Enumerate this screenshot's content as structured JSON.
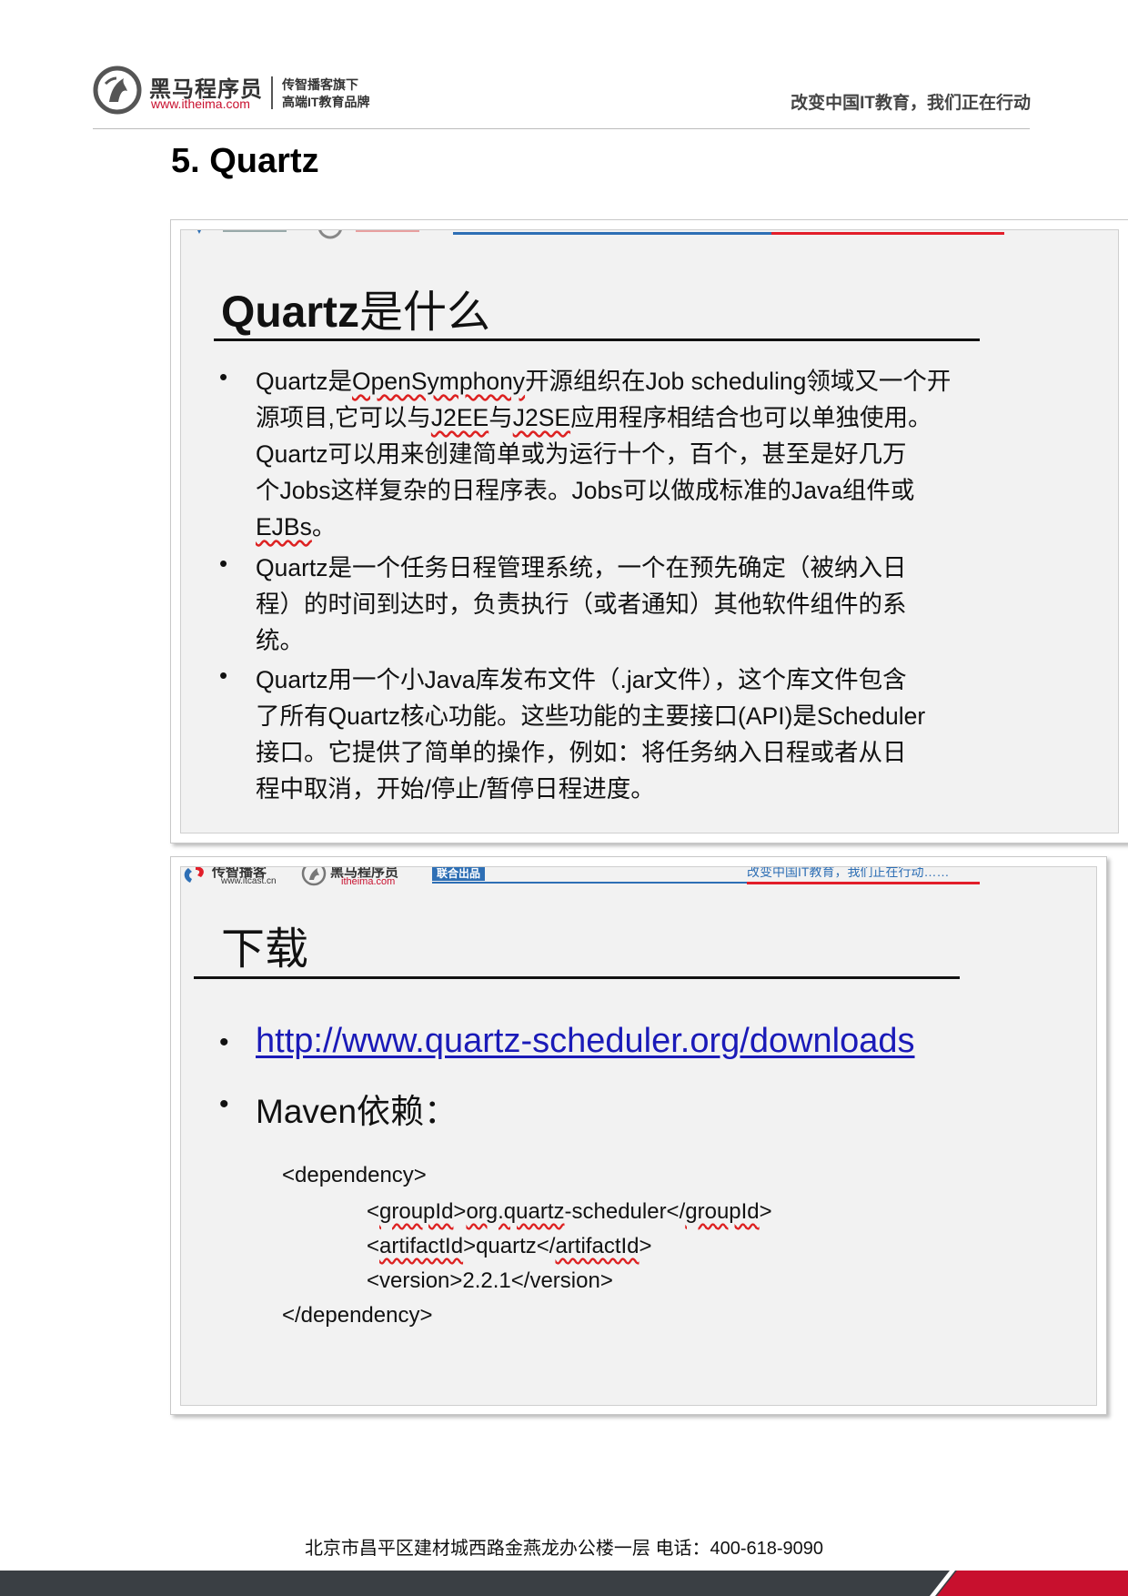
{
  "header": {
    "logo_name": "黑马程序员",
    "logo_url": "www.itheima.com",
    "logo_sub1": "传智播客旗下",
    "logo_sub2": "高端IT教育品牌",
    "slogan": "改变中国IT教育，我们正在行动"
  },
  "section_title": "5. Quartz",
  "slide1": {
    "title_lat": "Quartz",
    "title_cjk": "是什么",
    "bullets": [
      [
        [
          "Quartz是",
          "OpenSymphony",
          "开源组织在Job scheduling领域又一个开"
        ],
        [
          "源项目,它可以与",
          "J2EE",
          "与",
          "J2SE",
          "应用程序相结合也可以单独使用。"
        ],
        [
          "Quartz可以用来创建简单或为运行十个，百个，甚至是好几万"
        ],
        [
          "个Jobs这样复杂的日程序表。Jobs可以做成标准的Java组件或"
        ],
        [
          "EJBs",
          "。"
        ]
      ],
      [
        [
          "Quartz是一个任务日程管理系统，一个在预先确定（被纳入日"
        ],
        [
          "程）的时间到达时，负责执行（或者通知）其他软件组件的系"
        ],
        [
          "统。"
        ]
      ],
      [
        [
          "Quartz用一个小Java库发布文件（.jar文件），这个库文件包含"
        ],
        [
          "了所有Quartz核心功能。这些功能的主要接口(API)是Scheduler"
        ],
        [
          "接口。它提供了简单的操作，例如：将任务纳入日程或者从日"
        ],
        [
          "程中取消，开始/停止/暂停日程进度。"
        ]
      ]
    ]
  },
  "slide2": {
    "band": {
      "logo1_name": "传智播客",
      "logo1_url": "www.itcast.cn",
      "logo2_name": "黑马程序员",
      "logo2_url": "itheima.com",
      "tag": "联合出品",
      "slogan": "改变中国IT教育，我们正在行动……"
    },
    "title": "下载",
    "link": "http://www.quartz-scheduler.org/downloads",
    "maven_label": "Maven依赖：",
    "code": {
      "line1": "<dependency>",
      "line2_a": "<",
      "line2_b": "groupId",
      "line2_c": ">",
      "line2_d": "org.quartz",
      "line2_e": "-scheduler</",
      "line2_f": "groupId",
      "line2_g": ">",
      "line3_a": "<",
      "line3_b": "artifactId",
      "line3_c": ">quartz</",
      "line3_d": "artifactId",
      "line3_e": ">",
      "line4": "<version>2.2.1</version>",
      "line5": "</dependency>"
    }
  },
  "footer": {
    "address": "北京市昌平区建材城西路金燕龙办公楼一层   电话：400-618-9090"
  },
  "colors": {
    "accent_red": "#c8102e",
    "band_blue": "#2e6fb5",
    "band_red": "#e21e2a",
    "link_blue": "#1a1ab8",
    "footer_dark": "#3a3f44"
  }
}
